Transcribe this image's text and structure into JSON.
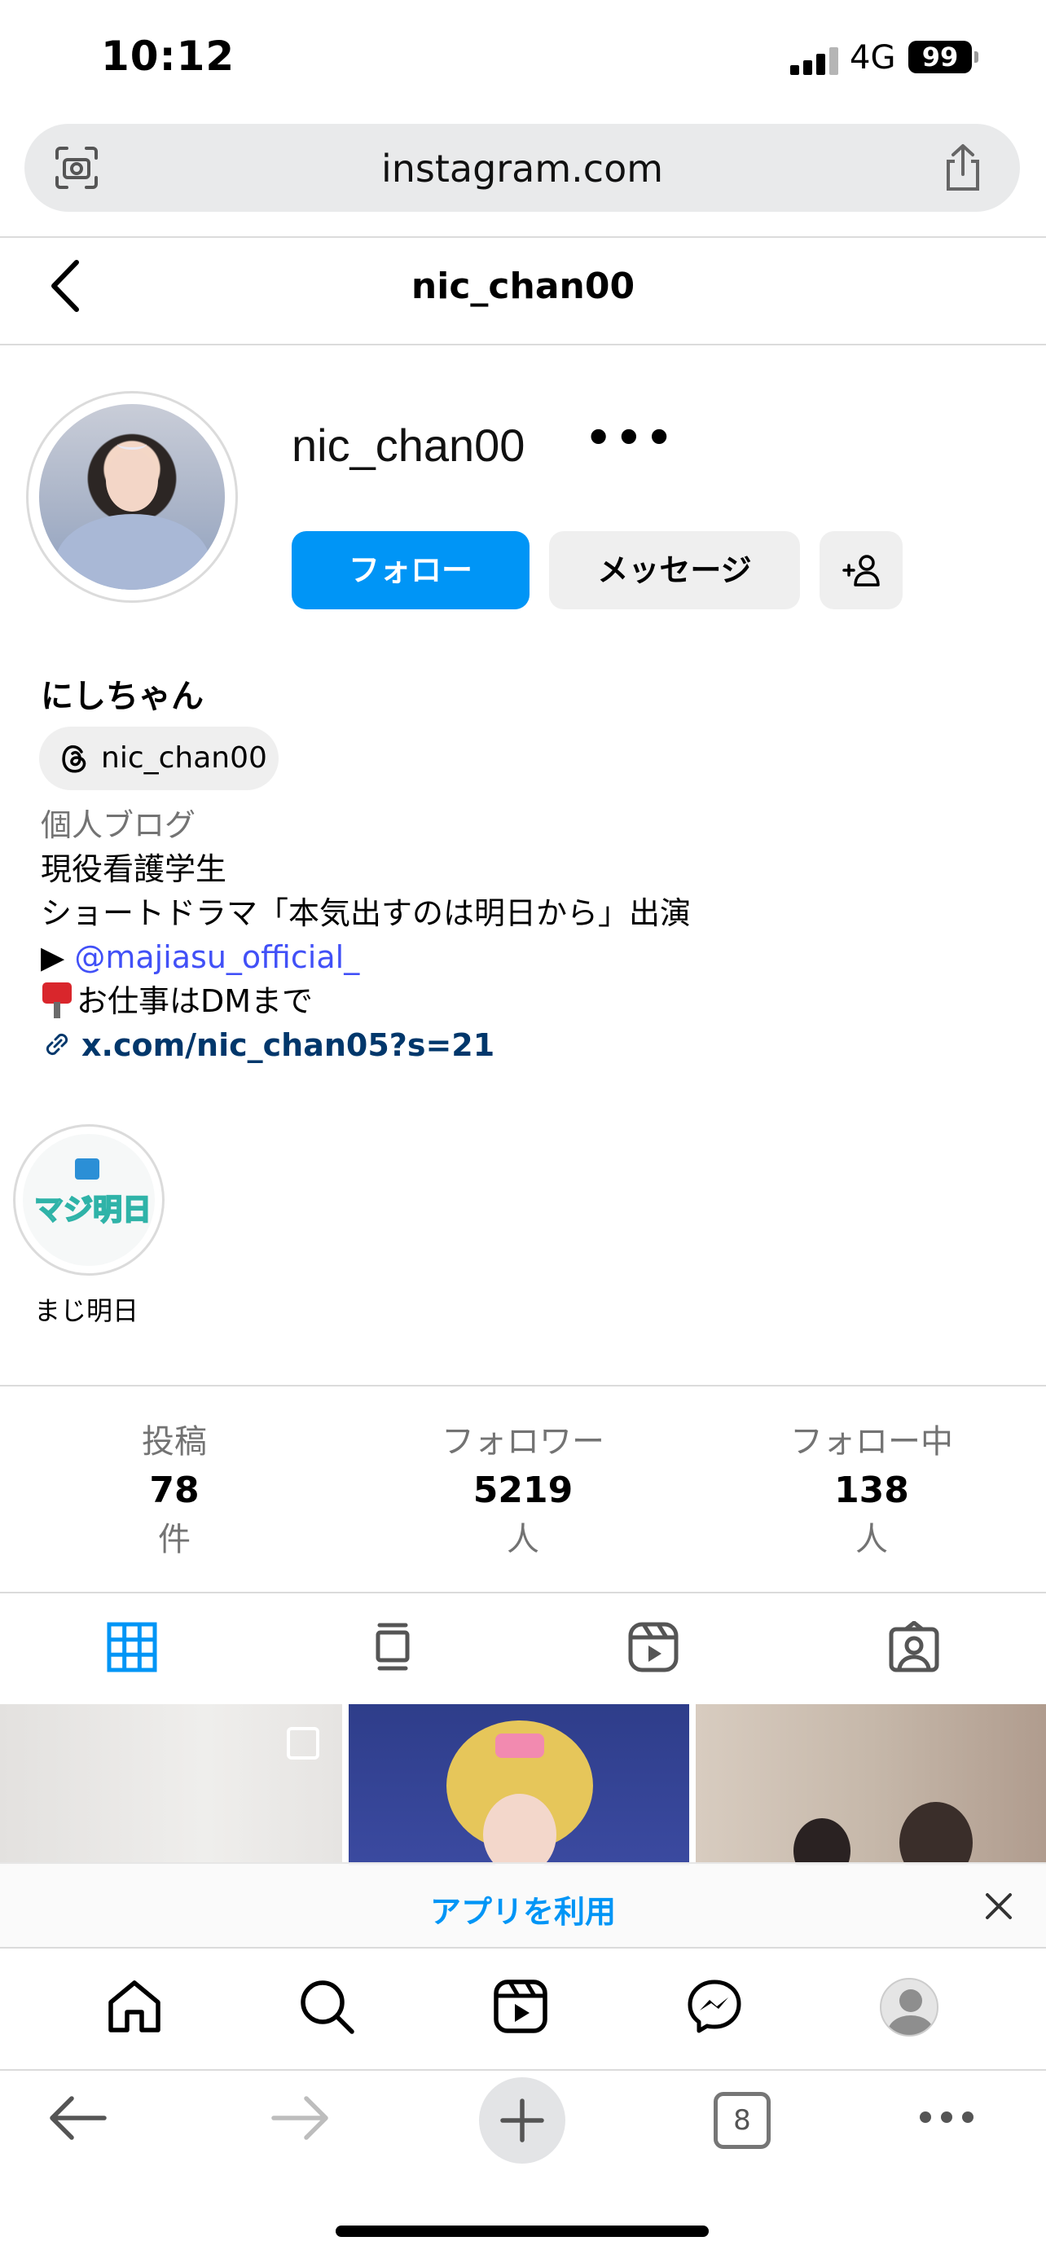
{
  "status_bar": {
    "time": "10:12",
    "network": "4G",
    "battery": "99"
  },
  "browser": {
    "url": "instagram.com",
    "tab_count": "8"
  },
  "header": {
    "title": "nic_chan00"
  },
  "profile": {
    "username": "nic_chan00",
    "more": "•••",
    "follow_label": "フォロー",
    "message_label": "メッセージ",
    "display_name": "にしちゃん",
    "threads_handle": "nic_chan00",
    "category": "個人ブログ",
    "bio_line1": "現役看護学生",
    "bio_line2": "ショートドラマ「本気出すのは明日から」出演",
    "bio_line3_prefix": "▶",
    "bio_line3_mention": "@majiasu_official_",
    "bio_line4": "お仕事はDMまで",
    "bio_link": "x.com/nic_chan05?s=21"
  },
  "highlight": {
    "label": "まじ明日",
    "logo_text": "マジ明日"
  },
  "stats": [
    {
      "label": "投稿",
      "value": "78",
      "unit": "件"
    },
    {
      "label": "フォロワー",
      "value": "5219",
      "unit": "人"
    },
    {
      "label": "フォロー中",
      "value": "138",
      "unit": "人"
    }
  ],
  "app_banner": {
    "text": "アプリを利用"
  },
  "colors": {
    "accent": "#0095f6",
    "mention": "#4150f7",
    "link": "#00376b",
    "muted": "#737373"
  },
  "icons": [
    "camera-scan-icon",
    "share-icon",
    "back-chevron-icon",
    "add-person-icon",
    "threads-icon",
    "link-icon",
    "mailbox-icon",
    "grid-icon",
    "feed-icon",
    "reels-icon",
    "tagged-icon",
    "home-icon",
    "search-icon",
    "reels-nav-icon",
    "messenger-icon",
    "close-icon",
    "back-arrow-icon",
    "forward-arrow-icon",
    "plus-icon",
    "more-icon"
  ]
}
